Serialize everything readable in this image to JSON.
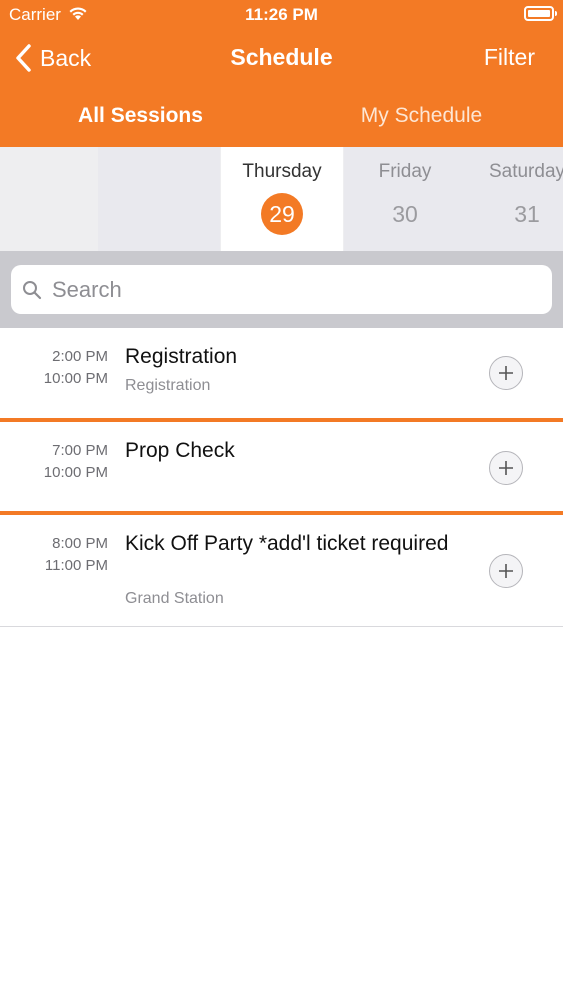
{
  "status_bar": {
    "carrier": "Carrier",
    "time": "11:26 PM"
  },
  "nav": {
    "back_label": "Back",
    "title": "Schedule",
    "filter_label": "Filter"
  },
  "segments": [
    {
      "label": "All Sessions",
      "selected": true
    },
    {
      "label": "My Schedule",
      "selected": false
    }
  ],
  "days": [
    {
      "name": "Thursday",
      "number": "29",
      "selected": true
    },
    {
      "name": "Friday",
      "number": "30",
      "selected": false
    },
    {
      "name": "Saturday",
      "number": "31",
      "selected": false
    }
  ],
  "search": {
    "placeholder": "Search",
    "value": ""
  },
  "sessions": [
    {
      "start": "2:00 PM",
      "end": "10:00 PM",
      "title": "Registration",
      "location": "Registration"
    },
    {
      "start": "7:00 PM",
      "end": "10:00 PM",
      "title": "Prop Check",
      "location": ""
    },
    {
      "start": "8:00 PM",
      "end": "11:00 PM",
      "title": "Kick Off Party *add'l ticket required",
      "location": "Grand Station"
    }
  ],
  "colors": {
    "accent": "#f37a25",
    "search_bg": "#c9c9ce",
    "day_bg": "#e9e9ee"
  },
  "icons": {
    "back": "chevron-left-icon",
    "search": "magnifier-icon",
    "add": "plus-icon",
    "wifi": "wifi-icon",
    "battery": "battery-icon"
  }
}
